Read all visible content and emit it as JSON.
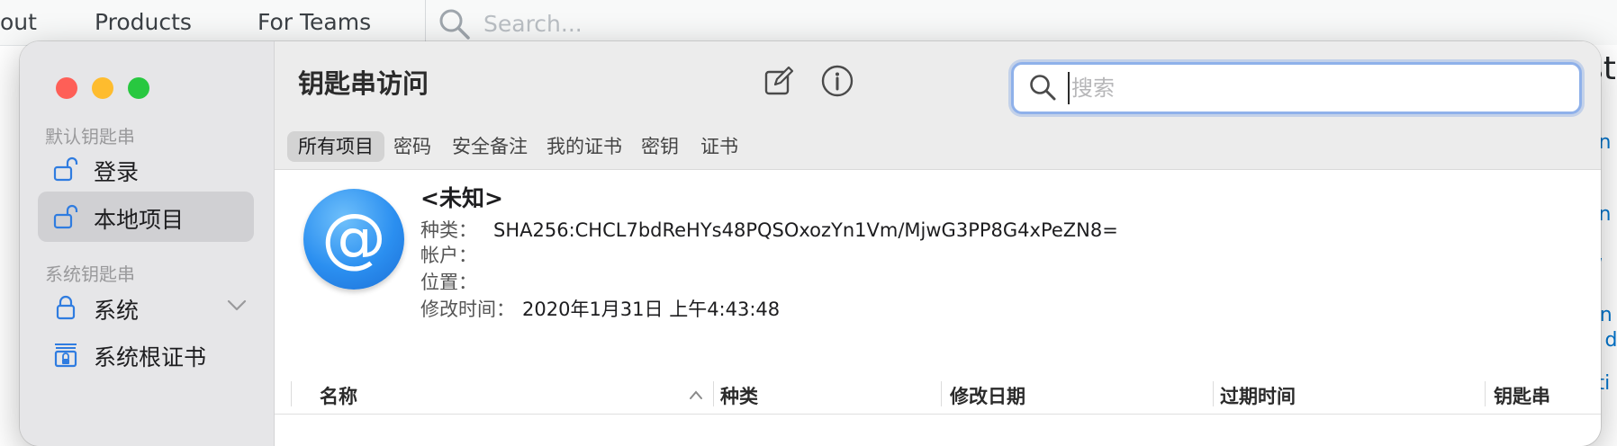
{
  "background_page": {
    "nav": [
      "out",
      "Products",
      "For Teams"
    ],
    "search_placeholder": "Search...",
    "right_fragments": [
      "st",
      "on",
      "on",
      "w",
      "f n",
      "o d",
      "sti",
      "?"
    ]
  },
  "window": {
    "title": "钥匙串访问",
    "search": {
      "placeholder": "搜索",
      "value": ""
    },
    "toolbar_icons": [
      "compose-icon",
      "info-icon"
    ],
    "sidebar": {
      "section_default": "默认钥匙串",
      "default_items": [
        {
          "label": "登录",
          "icon": "unlocked-padlock-icon",
          "selected": false
        },
        {
          "label": "本地项目",
          "icon": "unlocked-padlock-icon",
          "selected": true
        }
      ],
      "section_system": "系统钥匙串",
      "system_items": [
        {
          "label": "系统",
          "icon": "locked-padlock-icon"
        },
        {
          "label": "系统根证书",
          "icon": "cabinet-lock-icon"
        }
      ]
    },
    "tabs": [
      "所有项目",
      "密码",
      "安全备注",
      "我的证书",
      "密钥",
      "证书"
    ],
    "active_tab": "所有项目",
    "detail": {
      "name": "<未知>",
      "kind_label": "种类：",
      "kind_value": "SHA256:CHCL7bdReHYs48PQSOxozYn1Vm/MjwG3PP8G4xPeZN8=",
      "account_label": "帐户：",
      "account_value": "",
      "where_label": "位置：",
      "where_value": "",
      "modified_label": "修改时间：",
      "modified_value": "2020年1月31日 上午4:43:48"
    },
    "table_columns": [
      "名称",
      "种类",
      "修改日期",
      "过期时间",
      "钥匙串"
    ]
  },
  "colors": {
    "close": "#fe5f57",
    "minimize": "#febc2e",
    "zoom": "#28c840",
    "accent": "#2f7ce0"
  }
}
